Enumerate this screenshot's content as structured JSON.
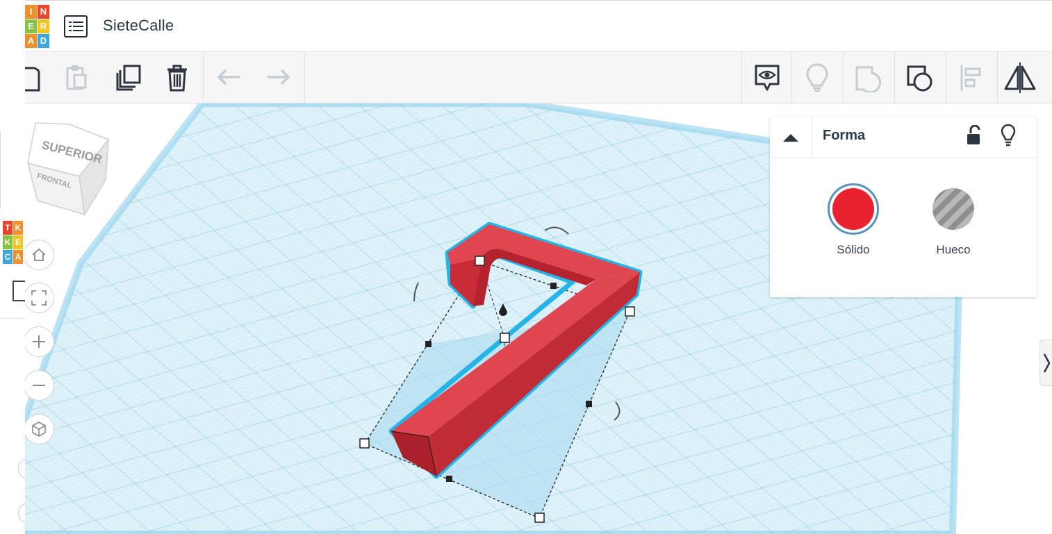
{
  "app": {
    "logo_letters": [
      "T",
      "I",
      "N",
      "K",
      "E",
      "R",
      "C",
      "A",
      "D"
    ],
    "logo_grid": [
      "I",
      "N",
      "E",
      "R",
      "A",
      "D"
    ],
    "mini_logo": [
      "T",
      "K",
      "K",
      "E",
      "C",
      "A"
    ],
    "project_title": "SieteCalle",
    "brand_colors": {
      "red": "#e8452c",
      "orange": "#f0902a",
      "green": "#84c441",
      "blue": "#3fa6dc",
      "yellow": "#f2c420"
    }
  },
  "toolbar": {
    "left_tools": [
      {
        "name": "copy",
        "icon": "copy-icon",
        "enabled": true
      },
      {
        "name": "paste",
        "icon": "paste-icon",
        "enabled": false
      },
      {
        "name": "duplicate",
        "icon": "duplicate-icon",
        "enabled": true
      },
      {
        "name": "delete",
        "icon": "trash-icon",
        "enabled": true
      },
      {
        "name": "undo",
        "icon": "undo-icon",
        "enabled": false
      },
      {
        "name": "redo",
        "icon": "redo-icon",
        "enabled": false
      }
    ],
    "right_tools": [
      {
        "name": "notes",
        "icon": "eye-comment-icon",
        "enabled": true
      },
      {
        "name": "show-all",
        "icon": "lightbulb-icon",
        "enabled": false
      },
      {
        "name": "group",
        "icon": "group-icon",
        "enabled": false
      },
      {
        "name": "ungroup",
        "icon": "ungroup-icon",
        "enabled": true
      },
      {
        "name": "align",
        "icon": "align-icon",
        "enabled": false
      },
      {
        "name": "mirror",
        "icon": "mirror-icon",
        "enabled": true
      }
    ]
  },
  "viewcube": {
    "top_label": "SUPERIOR",
    "front_label": "FRONTAL"
  },
  "nav_buttons": [
    {
      "name": "home",
      "icon": "home-icon"
    },
    {
      "name": "fit",
      "icon": "fit-view-icon"
    },
    {
      "name": "zoom-in",
      "icon": "plus-icon"
    },
    {
      "name": "zoom-out",
      "icon": "minus-icon"
    },
    {
      "name": "ortho",
      "icon": "cube-icon"
    }
  ],
  "shape_panel": {
    "title": "Forma",
    "options": [
      {
        "label": "Sólido",
        "color": "#e8222e",
        "selected": true
      },
      {
        "label": "Hueco",
        "color": "#a9a9a9",
        "selected": false
      }
    ]
  },
  "colors": {
    "grid": "#bfe3f2",
    "grid_major": "#8fcbe6",
    "shape_red": "#dd3540",
    "selection": "#2bb3e8"
  }
}
